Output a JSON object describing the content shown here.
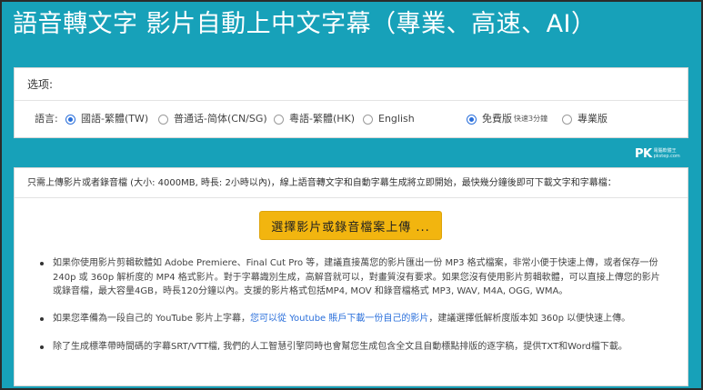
{
  "page": {
    "title": "語音轉文字 影片自動上中文字幕（專業、高速、AI）"
  },
  "options": {
    "header": "选项:",
    "language_label": "語言:",
    "languages": [
      {
        "label": "國語-繁體(TW)",
        "selected": true
      },
      {
        "label": "普通话-简体(CN/SG)",
        "selected": false
      },
      {
        "label": "粵語-繁體(HK)",
        "selected": false
      },
      {
        "label": "English",
        "selected": false
      }
    ],
    "plans": [
      {
        "label": "免費版",
        "note": "快速3分鐘",
        "selected": true
      },
      {
        "label": "專業版",
        "note": "",
        "selected": false
      }
    ]
  },
  "watermark": {
    "logo": "PK",
    "site_top": "電腦軟體王",
    "site_bottom": "pkstep.com"
  },
  "main": {
    "intro": "只需上傳影片或者錄音檔 (大小: 4000MB, 時長: 2小時以內)，線上語音轉文字和自動字幕生成將立即開始，最快幾分鐘後即可下載文字和字幕檔：",
    "upload_button": "選擇影片或錄音檔案上傳 ...",
    "bullets": {
      "b1": "如果你使用影片剪輯軟體如 Adobe Premiere、Final Cut Pro 等，建議直接萬您的影片匯出一份 MP3 格式檔案，非常小便于快速上傳，或者保存一份 240p 或 360p 解析度的 MP4 格式影片。對于字幕識別生成，高解音就可以，對畫質沒有要求。如果您沒有使用影片剪輯軟體，可以直接上傳您的影片或錄音檔，最大容量4GB，時長120分鐘以內。支援的影片格式包括MP4, MOV 和錄音檔格式 MP3, WAV, M4A, OGG, WMA。",
      "b2_pre": "如果您準備為一段自己的 YouTube 影片上字幕，",
      "b2_link": "您可以從 Youtube 賬戶下載一份自己的影片",
      "b2_post": "，建議選擇低解析度版本如 360p 以便快速上傳。",
      "b3": "除了生成標準帶時間碼的字幕SRT/VTT檔, 我們的人工智慧引擎同時也會幫您生成包含全文且自動標點排版的逐字稿，提供TXT和Word檔下載。"
    }
  }
}
